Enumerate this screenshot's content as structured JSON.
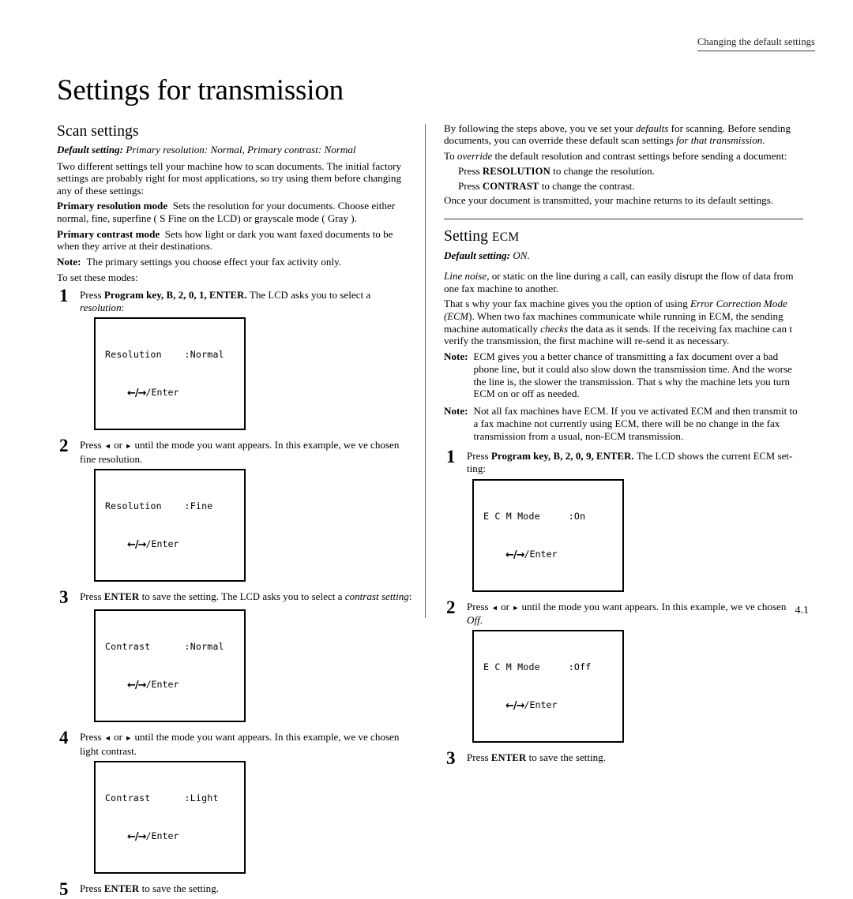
{
  "running_head": "Changing the default settings",
  "chapter_title": "Settings for transmission",
  "folio": "4.1",
  "left_column": {
    "section_title": "Scan settings",
    "default_setting_label": "Default setting:",
    "default_setting_value": "Primary resolution: Normal, Primary contrast: Normal",
    "intro": "Two different settings tell your machine how to scan documents. The initial factory settings are probably right for most applications, so try using them before changing any of these settings:",
    "terms": [
      {
        "term": "Primary resolution mode",
        "desc_a": "Sets the resolution for your documents. Choose either normal, fine, superfine ( S Fine  on the ",
        "desc_sc": "LCD",
        "desc_b": ") or grayscale mode ( Gray )."
      },
      {
        "term": "Primary contrast mode",
        "desc_a": "Sets how light or dark you want faxed documents to be when they arrive at their destinations.",
        "desc_sc": "",
        "desc_b": ""
      }
    ],
    "note_label": "Note:",
    "note_text": "The primary settings you choose effect your fax activity only.",
    "to_set": "To set these modes:",
    "steps": [
      {
        "num": "1",
        "text_a": "Press ",
        "bold": "Program key, ",
        "bold_sc1": "B",
        "bold_mid": ", 2, 0, 1, ",
        "bold_sc2": "ENTER.",
        "text_b": " The ",
        "sc": "LCD",
        "text_c": " asks you to select a ",
        "italic": "resolution",
        "text_d": ":"
      },
      {
        "num": "2",
        "text_a": "Press ",
        "arrows": true,
        "text_b": " until the mode you want appears. In this example, we ve chosen fine resolution."
      },
      {
        "num": "3",
        "text_a": "Press ",
        "bold_sc": "ENTER",
        "text_b": " to save the setting. The ",
        "sc": "LCD",
        "text_c": " asks you to select a ",
        "italic": "contrast setting",
        "text_d": ":"
      },
      {
        "num": "4",
        "text_a": "Press ",
        "arrows": true,
        "text_b": " until the mode you want appears. In this example, we ve chosen light contrast."
      },
      {
        "num": "5",
        "text_a": "Press ",
        "bold_sc": "ENTER",
        "text_b": " to save the setting."
      }
    ],
    "lcd_screens": [
      {
        "line1_label": "Resolution",
        "line1_value": ":Normal",
        "line2": "/Enter",
        "pad": 4
      },
      {
        "line1_label": "Resolution",
        "line1_value": ":Fine",
        "line2": "/Enter",
        "pad": 4
      },
      {
        "line1_label": "Contrast",
        "line1_value": ":Normal",
        "line2": "/Enter",
        "pad": 6
      },
      {
        "line1_label": "Contrast",
        "line1_value": ":Light",
        "line2": "/Enter",
        "pad": 6
      }
    ]
  },
  "right_column": {
    "intro_p1_a": "By following the steps above, you ve set your ",
    "intro_p1_i1": "defaults",
    "intro_p1_b": " for scanning. Before sending documents, you can  override  these default scan settings ",
    "intro_p1_i2": "for that transmission",
    "intro_p1_c": ".",
    "intro_p2_a": "To ",
    "intro_p2_i": "override",
    "intro_p2_b": " the default resolution and contrast settings before sending a document:",
    "press_resolution_a": "Press ",
    "press_resolution_sc": "RESOLUTION",
    "press_resolution_b": " to change the resolution.",
    "press_contrast_a": "Press ",
    "press_contrast_sc": "CONTRAST",
    "press_contrast_b": " to change the contrast.",
    "returns": "Once your document is transmitted, your machine returns to its default settings.",
    "section_title_a": "Setting ",
    "section_title_sc": "ECM",
    "default_setting_label": "Default setting:",
    "default_setting_value": " ON.",
    "line_noise_i": " Line noise, ",
    "line_noise_rest": " or static on the line during a call, can easily disrupt the flow of data from one fax machine to another.",
    "ecm_para_a": "That s why your fax machine gives you the option of using ",
    "ecm_para_i1": "Error Correction Mode",
    "ecm_para_b": " (",
    "ecm_para_sc1": "ECM",
    "ecm_para_c": "). When two fax machines communicate while running in ",
    "ecm_para_sc2": "ECM",
    "ecm_para_d": ", the sending machine automatically ",
    "ecm_para_i2": "checks",
    "ecm_para_e": " the data as it sends. If the receiving fax machine can t verify the transmission, the first machine will re-send it as necessary.",
    "note1_label": "Note:",
    "note1_sc": "ECM",
    "note1_a": " gives you a better chance of transmitting a fax document over a bad phone line, but it could also slow down the transmission time. And the worse the line is, the slower the transmission. That s why the machine lets you turn ",
    "note1_sc2": "ECM",
    "note1_b": " on or off as needed.",
    "note2_label": "Note:",
    "note2_a": "Not all fax machines have ",
    "note2_sc1": "ECM",
    "note2_b": ". If you ve activated ",
    "note2_sc2": "ECM",
    "note2_c": " and then transmit to a fax machine not currently using ",
    "note2_sc3": "ECM",
    "note2_d": ", there will be no change in the fax transmission from a usual, non-",
    "note2_sc4": "ECM",
    "note2_e": " transmission.",
    "steps": [
      {
        "num": "1",
        "text_a": "Press ",
        "bold": "Program key, ",
        "bold_sc1": "B",
        "bold_mid": ", 2, 0, 9, ",
        "bold_sc2": "ENTER.",
        "text_b": " The ",
        "sc": "LCD",
        "text_c": " shows the current ",
        "sc2": "ECM",
        "text_d": " set-ting:"
      },
      {
        "num": "2",
        "text_a": "Press ",
        "arrows": true,
        "text_b": " until the mode you want appears. In this example, we ve chosen ",
        "italic": "Off",
        "text_c": "."
      },
      {
        "num": "3",
        "text_a": "Press ",
        "bold_sc": "ENTER",
        "text_b": " to save the setting."
      }
    ],
    "lcd_screens": [
      {
        "line1_label": "E C M Mode",
        "line1_value": ":On",
        "line2": "/Enter"
      },
      {
        "line1_label": "E C M Mode",
        "line1_value": ":Off",
        "line2": "/Enter"
      }
    ]
  }
}
